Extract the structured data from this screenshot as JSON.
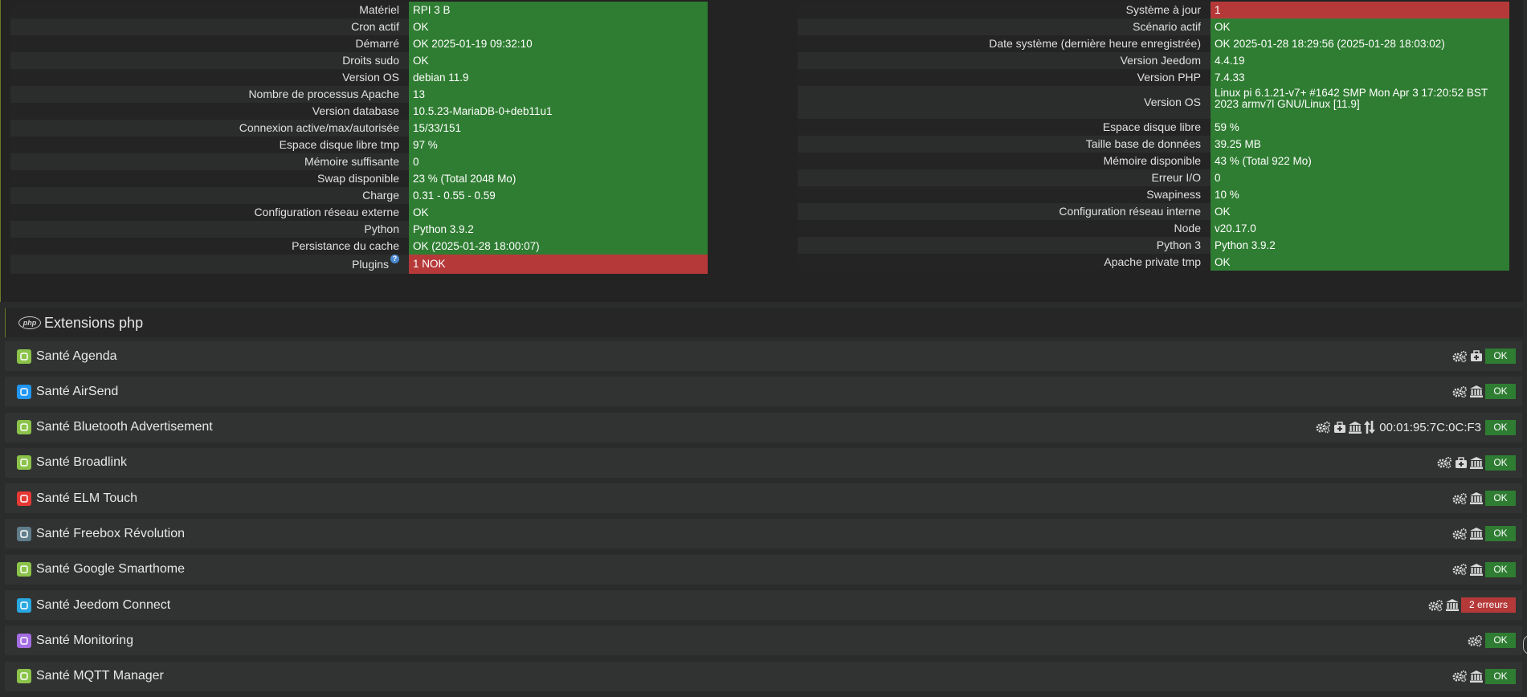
{
  "health": {
    "left": [
      {
        "label": "Matériel",
        "value": "RPI 3 B",
        "status": "ok"
      },
      {
        "label": "Cron actif",
        "value": "OK",
        "status": "ok"
      },
      {
        "label": "Démarré",
        "value": "OK 2025-01-19 09:32:10",
        "status": "ok"
      },
      {
        "label": "Droits sudo",
        "value": "OK",
        "status": "ok"
      },
      {
        "label": "Version OS",
        "value": "debian 11.9",
        "status": "ok"
      },
      {
        "label": "Nombre de processus Apache",
        "value": "13",
        "status": "ok"
      },
      {
        "label": "Version database",
        "value": "10.5.23-MariaDB-0+deb11u1",
        "status": "ok"
      },
      {
        "label": "Connexion active/max/autorisée",
        "value": "15/33/151",
        "status": "ok"
      },
      {
        "label": "Espace disque libre tmp",
        "value": "97 %",
        "status": "ok"
      },
      {
        "label": "Mémoire suffisante",
        "value": "0",
        "status": "ok"
      },
      {
        "label": "Swap disponible",
        "value": "23 % (Total 2048 Mo)",
        "status": "ok"
      },
      {
        "label": "Charge",
        "value": "0.31 - 0.55 - 0.59",
        "status": "ok"
      },
      {
        "label": "Configuration réseau externe",
        "value": "OK",
        "status": "ok"
      },
      {
        "label": "Python",
        "value": "Python 3.9.2",
        "status": "ok"
      },
      {
        "label": "Persistance du cache",
        "value": "OK (2025-01-28 18:00:07)",
        "status": "ok"
      },
      {
        "label": "Plugins",
        "value": "1 NOK",
        "status": "nok"
      }
    ],
    "right": [
      {
        "label": "Système à jour",
        "value": "1",
        "status": "nok"
      },
      {
        "label": "Scénario actif",
        "value": "OK",
        "status": "ok"
      },
      {
        "label": "Date système (dernière heure enregistrée)",
        "value": "OK 2025-01-28 18:29:56 (2025-01-28 18:03:02)",
        "status": "ok"
      },
      {
        "label": "Version Jeedom",
        "value": "4.4.19",
        "status": "ok"
      },
      {
        "label": "Version PHP",
        "value": "7.4.33",
        "status": "ok"
      },
      {
        "label": "Version OS",
        "value": "Linux pi 6.1.21-v7+ #1642 SMP Mon Apr 3 17:20:52 BST 2023 armv7l GNU/Linux [11.9]",
        "status": "ok"
      },
      {
        "label": "Espace disque libre",
        "value": "59 %",
        "status": "ok"
      },
      {
        "label": "Taille base de données",
        "value": "39.25 MB",
        "status": "ok"
      },
      {
        "label": "Mémoire disponible",
        "value": "43 % (Total 922 Mo)",
        "status": "ok"
      },
      {
        "label": "Erreur I/O",
        "value": "0",
        "status": "ok"
      },
      {
        "label": "Swapiness",
        "value": "10 %",
        "status": "ok"
      },
      {
        "label": "Configuration réseau interne",
        "value": "OK",
        "status": "ok"
      },
      {
        "label": "Node",
        "value": "v20.17.0",
        "status": "ok"
      },
      {
        "label": "Python 3",
        "value": "Python 3.9.2",
        "status": "ok"
      },
      {
        "label": "Apache private tmp",
        "value": "OK",
        "status": "ok"
      }
    ],
    "plugins_help_icon": "question-circle-icon"
  },
  "section": {
    "title": "Extensions php",
    "icon": "php-icon"
  },
  "plugins": [
    {
      "name": "Santé Agenda",
      "icon_color": "#8bc34a",
      "icons": [
        "cogs-icon",
        "medkit-icon"
      ],
      "mac": "",
      "status": "OK",
      "status_type": "ok"
    },
    {
      "name": "Santé AirSend",
      "icon_color": "#2196f3",
      "icons": [
        "cogs-icon",
        "bank-icon"
      ],
      "mac": "",
      "status": "OK",
      "status_type": "ok"
    },
    {
      "name": "Santé Bluetooth Advertisement",
      "icon_color": "#8bc34a",
      "icons": [
        "cogs-icon",
        "medkit-icon",
        "bank-icon",
        "sort-icon"
      ],
      "mac": "00:01:95:7C:0C:F3",
      "status": "OK",
      "status_type": "ok"
    },
    {
      "name": "Santé Broadlink",
      "icon_color": "#8bc34a",
      "icons": [
        "cogs-icon",
        "medkit-icon",
        "bank-icon"
      ],
      "mac": "",
      "status": "OK",
      "status_type": "ok"
    },
    {
      "name": "Santé ELM Touch",
      "icon_color": "#e53935",
      "icons": [
        "cogs-icon",
        "bank-icon"
      ],
      "mac": "",
      "status": "OK",
      "status_type": "ok"
    },
    {
      "name": "Santé Freebox Révolution",
      "icon_color": "#607d8b",
      "icons": [
        "cogs-icon",
        "bank-icon"
      ],
      "mac": "",
      "status": "OK",
      "status_type": "ok"
    },
    {
      "name": "Santé Google Smarthome",
      "icon_color": "#8bc34a",
      "icons": [
        "cogs-icon",
        "bank-icon"
      ],
      "mac": "",
      "status": "OK",
      "status_type": "ok"
    },
    {
      "name": "Santé Jeedom Connect",
      "icon_color": "#29a8e0",
      "icons": [
        "cogs-icon",
        "bank-icon"
      ],
      "mac": "",
      "status": "2 erreurs",
      "status_type": "err"
    },
    {
      "name": "Santé Monitoring",
      "icon_color": "#a56de2",
      "icons": [
        "cogs-icon"
      ],
      "mac": "",
      "status": "OK",
      "status_type": "ok"
    },
    {
      "name": "Santé MQTT Manager",
      "icon_color": "#8bc34a",
      "icons": [
        "cogs-icon",
        "bank-icon"
      ],
      "mac": "",
      "status": "OK",
      "status_type": "ok"
    }
  ]
}
